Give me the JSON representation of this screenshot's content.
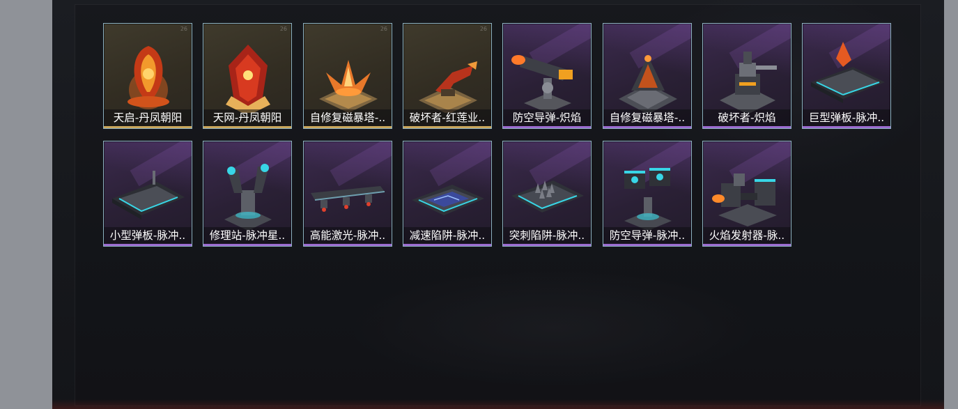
{
  "items": [
    {
      "label": "天启-丹凤朝阳",
      "rarity": "gold",
      "art": "phoenix-orb",
      "code": "26"
    },
    {
      "label": "天网-丹凤朝阳",
      "rarity": "gold",
      "art": "phoenix-crest",
      "code": "26"
    },
    {
      "label": "自修复磁暴塔-..",
      "rarity": "gold",
      "art": "flame-flower",
      "code": "26"
    },
    {
      "label": "破坏者-红莲业..",
      "rarity": "gold",
      "art": "flame-cannon",
      "code": "26"
    },
    {
      "label": "防空导弹-炽焰",
      "rarity": "purple",
      "art": "missile-turret",
      "code": ""
    },
    {
      "label": "自修复磁暴塔-..",
      "rarity": "purple",
      "art": "tesla-tower",
      "code": ""
    },
    {
      "label": "破坏者-炽焰",
      "rarity": "purple",
      "art": "heavy-turret",
      "code": ""
    },
    {
      "label": "巨型弹板-脉冲..",
      "rarity": "purple",
      "art": "big-pad",
      "code": ""
    },
    {
      "label": "小型弹板-脉冲..",
      "rarity": "purple",
      "art": "small-pad",
      "code": ""
    },
    {
      "label": "修理站-脉冲星..",
      "rarity": "purple",
      "art": "repair-station",
      "code": ""
    },
    {
      "label": "高能激光-脉冲..",
      "rarity": "purple",
      "art": "laser-rail",
      "code": ""
    },
    {
      "label": "减速陷阱-脉冲..",
      "rarity": "purple",
      "art": "slow-trap",
      "code": ""
    },
    {
      "label": "突刺陷阱-脉冲..",
      "rarity": "purple",
      "art": "spike-trap",
      "code": ""
    },
    {
      "label": "防空导弹-脉冲..",
      "rarity": "purple",
      "art": "pulse-missile",
      "code": ""
    },
    {
      "label": "火焰发射器-脉..",
      "rarity": "purple",
      "art": "flamethrower",
      "code": ""
    }
  ],
  "colors": {
    "gold": "#c9a65b",
    "purple": "#9b6bd0",
    "border": "#8eb3c2"
  }
}
